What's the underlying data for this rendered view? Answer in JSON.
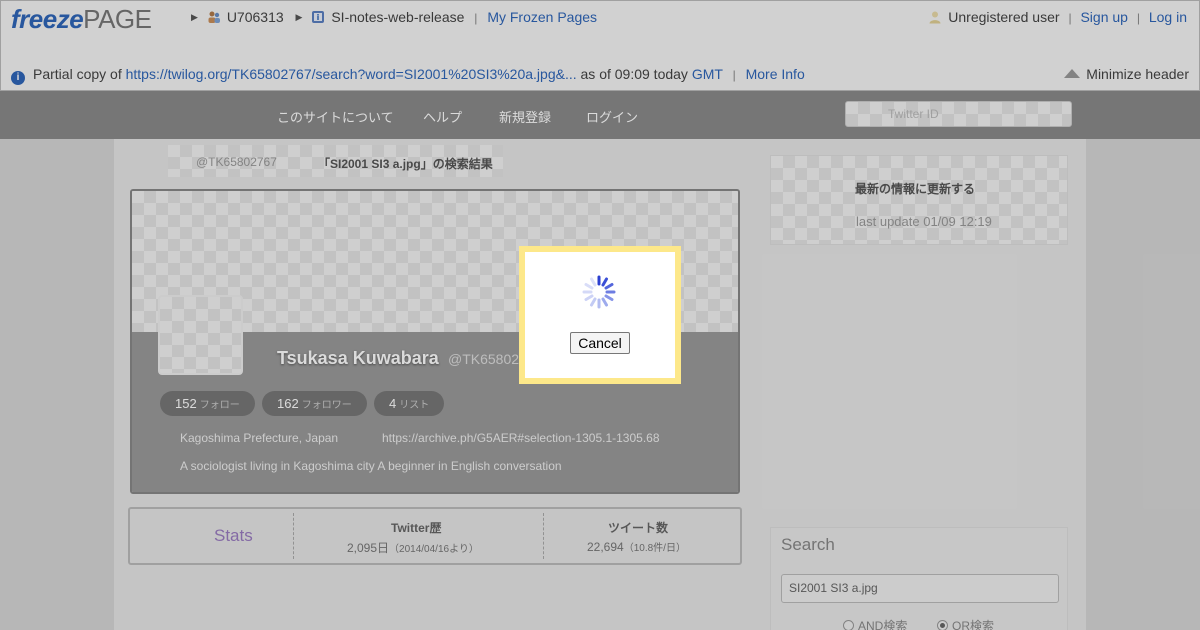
{
  "freezepage": {
    "logo_freeze": "freeze",
    "logo_page": "PAGE",
    "crumb_user": "U706313",
    "crumb_page": "SI-notes-web-release",
    "my_frozen_pages": "My Frozen Pages",
    "unregistered_user": "Unregistered user",
    "sign_up": "Sign up",
    "log_in": "Log in",
    "partial_prefix": "Partial copy of",
    "partial_url": "https://twilog.org/TK65802767/search?word=SI2001%20SI3%20a.jpg&...",
    "as_of": "as of 09:09 today",
    "gmt": "GMT",
    "more_info": "More Info",
    "minimize_header": "Minimize header"
  },
  "nav": {
    "items": [
      "このサイトについて",
      "ヘルプ",
      "新規登録",
      "ログイン"
    ],
    "search_placeholder": "Twitter ID"
  },
  "breadcrumb": {
    "handle": "@TK65802767",
    "title": "「SI2001 SI3 a.jpg」の検索結果"
  },
  "profile": {
    "name": "Tsukasa Kuwabara",
    "handle": "@TK65802",
    "follow_count": "152",
    "follow_label": "フォロー",
    "follower_count": "162",
    "follower_label": "フォロワー",
    "list_count": "4",
    "list_label": "リスト",
    "location": "Kagoshima Prefecture, Japan",
    "url": "https://archive.ph/G5AER#selection-1305.1-1305.68",
    "bio": "A sociologist living in Kagoshima city A beginner in English conversation"
  },
  "stats": {
    "label": "Stats",
    "history_title": "Twitter歴",
    "history_value": "2,095日",
    "history_since": "（2014/04/16より）",
    "tweets_title": "ツイート数",
    "tweets_value": "22,694",
    "tweets_rate": "（10.8件/日）"
  },
  "sidebar": {
    "update_title": "最新の情報に更新する",
    "last_update": "last update 01/09 12:19",
    "search_title": "Search",
    "search_value": "SI2001 SI3 a.jpg",
    "and_label": "AND検索",
    "or_label": "OR検索"
  },
  "modal": {
    "cancel_label": "Cancel"
  },
  "colors": {
    "link": "#2f66b8",
    "modal_border": "#fde88a",
    "spinner": "#3b4fd6",
    "stats_label": "#9a7cc0"
  }
}
